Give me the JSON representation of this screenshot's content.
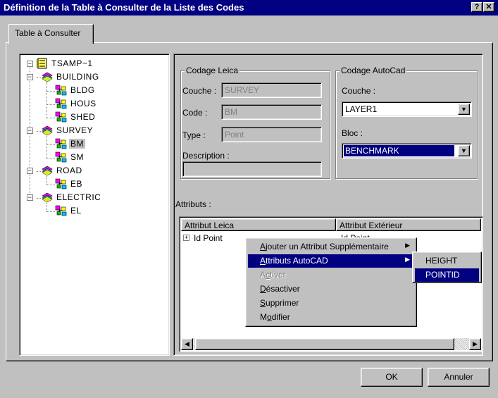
{
  "window": {
    "title": "Définition de la Table à Consulter de la Liste des Codes",
    "help_glyph": "?",
    "close_glyph": "✕"
  },
  "tab": {
    "label": "Table à Consulter"
  },
  "tree": {
    "root": {
      "label": "TSAMP~1",
      "icon": "database-book-icon"
    },
    "groups": [
      {
        "label": "BUILDING",
        "icon": "layer-icon",
        "children": [
          "BLDG",
          "HOUS",
          "SHED"
        ]
      },
      {
        "label": "SURVEY",
        "icon": "layer-icon",
        "children": [
          "BM",
          "SM"
        ]
      },
      {
        "label": "ROAD",
        "icon": "layer-icon",
        "children": [
          "EB"
        ]
      },
      {
        "label": "ELECTRIC",
        "icon": "layer-icon",
        "children": [
          "EL"
        ]
      }
    ],
    "selected": "BM",
    "expanded_glyph": "−"
  },
  "leica": {
    "title": "Codage Leica",
    "couche_label": "Couche :",
    "couche_value": "SURVEY",
    "code_label": "Code :",
    "code_value": "BM",
    "type_label": "Type :",
    "type_value": "Point",
    "description_label": "Description :",
    "description_value": ""
  },
  "autocad": {
    "title": "Codage AutoCad",
    "couche_label": "Couche :",
    "couche_value": "LAYER1",
    "bloc_label": "Bloc :",
    "bloc_value": "BENCHMARK",
    "arrow_glyph": "▼"
  },
  "attributes": {
    "label": "Attributs :",
    "columns": [
      "Attribut Leica",
      "Attribut Extérieur"
    ],
    "rows": [
      {
        "leica": "Id Point",
        "exterieur": "Id Point",
        "expander": "+"
      }
    ],
    "scroll_left": "◀",
    "scroll_right": "▶"
  },
  "context_menu": {
    "items": [
      {
        "label": "Ajouter un Attribut Supplémentaire",
        "has_submenu": true,
        "state": "normal"
      },
      {
        "label": "Attributs AutoCAD",
        "has_submenu": true,
        "state": "active"
      },
      {
        "label": "Activer",
        "has_submenu": false,
        "state": "disabled"
      },
      {
        "label": "Désactiver",
        "has_submenu": false,
        "state": "normal"
      },
      {
        "label": "Supprimer",
        "has_submenu": false,
        "state": "normal"
      },
      {
        "label": "Modifier",
        "has_submenu": false,
        "state": "normal"
      }
    ],
    "submenu_glyph": "▶"
  },
  "submenu": {
    "items": [
      "HEIGHT",
      "POINTID"
    ],
    "selected": "POINTID"
  },
  "buttons": {
    "ok": "OK",
    "cancel": "Annuler"
  },
  "colors": {
    "title_bar": "#000080",
    "face": "#c0c0c0",
    "highlight": "#000080"
  }
}
